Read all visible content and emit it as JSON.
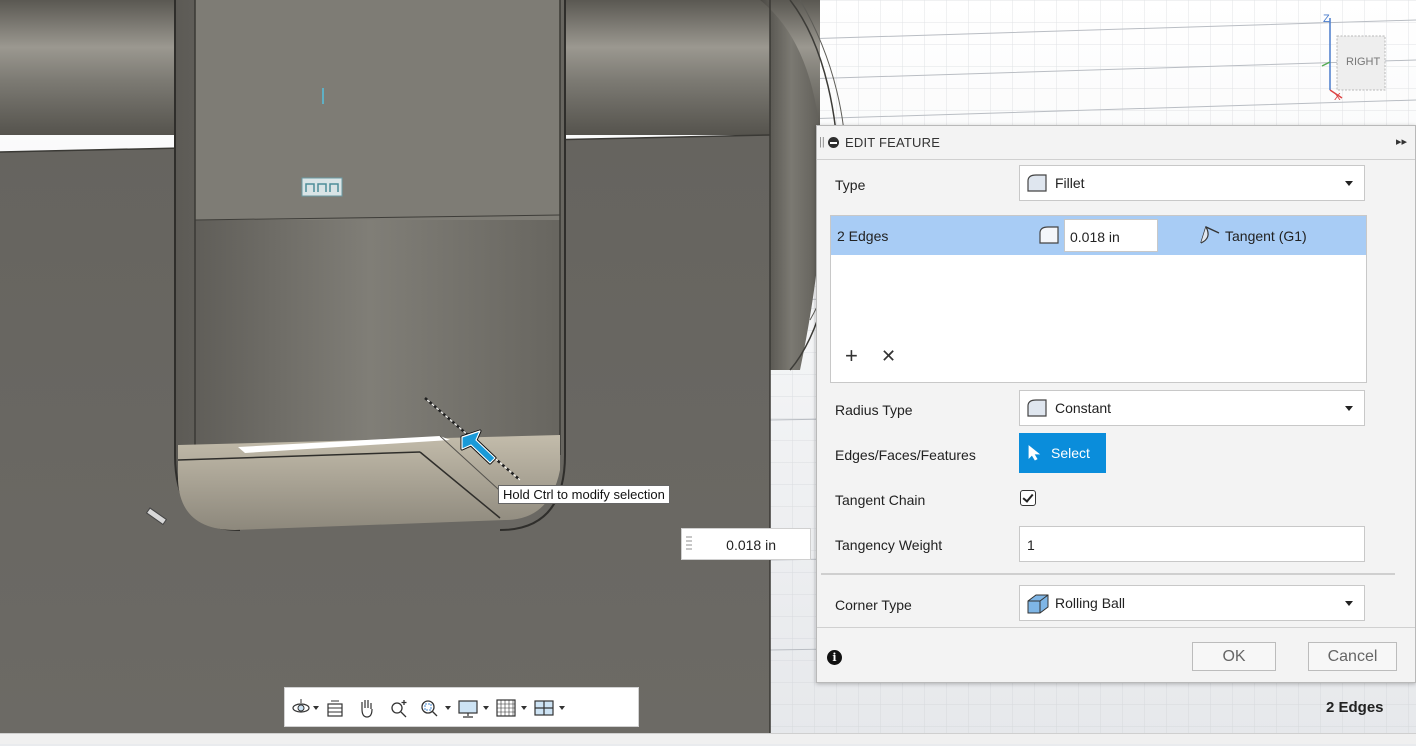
{
  "dialog": {
    "title": "EDIT FEATURE",
    "type_label": "Type",
    "type_value": "Fillet",
    "edges": [
      {
        "name": "2 Edges",
        "radius": "0.018 in",
        "continuity": "Tangent (G1)"
      }
    ],
    "radius_type_label": "Radius Type",
    "radius_type_value": "Constant",
    "selection_label": "Edges/Faces/Features",
    "select_button": "Select",
    "tangent_chain_label": "Tangent Chain",
    "tangent_chain_checked": true,
    "tangency_weight_label": "Tangency Weight",
    "tangency_weight_value": "1",
    "corner_type_label": "Corner Type",
    "corner_type_value": "Rolling Ball",
    "ok_label": "OK",
    "cancel_label": "Cancel"
  },
  "viewport": {
    "tooltip": "Hold Ctrl to modify selection",
    "dimension_value": "0.018 in",
    "selection_status": "2 Edges",
    "viewcube_face": "RIGHT",
    "axis_z": "Z",
    "axis_x": "X"
  },
  "colors": {
    "accent": "#0a8ddb",
    "selected_row": "#a8ccf5",
    "model": "#6b6b66"
  },
  "nav_toolbar": [
    "orbit-icon",
    "look-at-icon",
    "pan-icon",
    "zoom-icon",
    "fit-icon",
    "display-settings-icon",
    "grid-icon",
    "viewports-icon"
  ]
}
